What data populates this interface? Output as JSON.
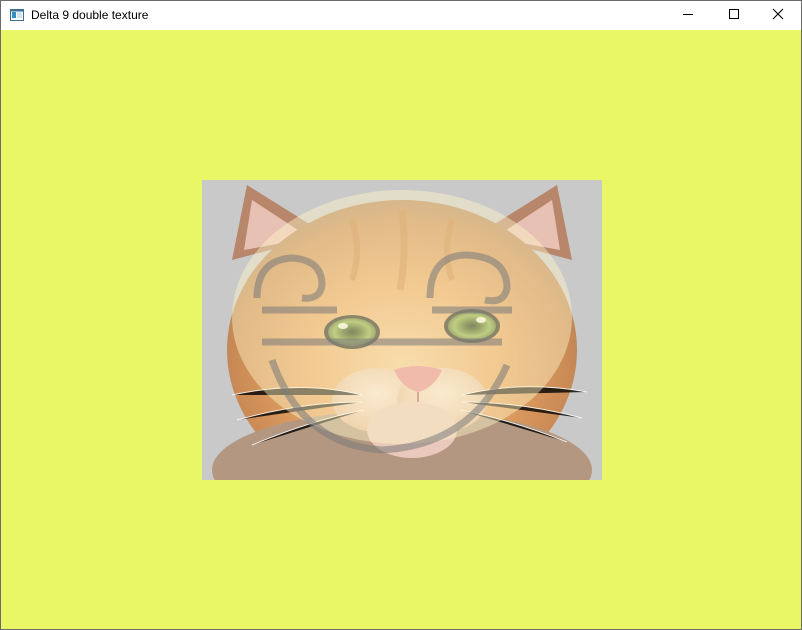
{
  "window": {
    "title": "Delta 9 double texture",
    "icon": "app-window-icon",
    "controls": {
      "minimize": "minimize-icon",
      "maximize": "maximize-icon",
      "close": "close-icon"
    }
  },
  "scene": {
    "clear_color": "#e9f766",
    "texture1": "kitten-photo",
    "texture2": "smiley-face",
    "texture_bg_color": "#c9c9c9"
  }
}
